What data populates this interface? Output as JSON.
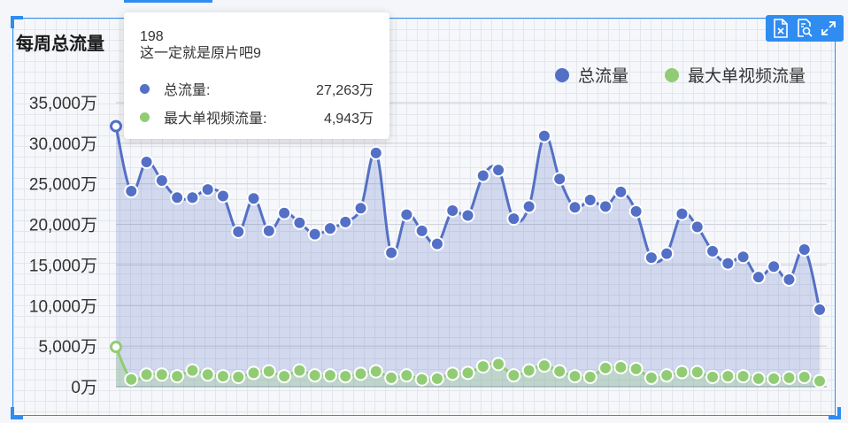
{
  "title": "每周总流量",
  "toolbar": {
    "icons": [
      "export-file-icon",
      "search-report-icon",
      "fullscreen-icon"
    ]
  },
  "tooltip": {
    "header_line1": "198",
    "header_line2": "这一定就是原片吧9",
    "rows": [
      {
        "name": "总流量:",
        "value": "27,263万",
        "color": "#5470c6"
      },
      {
        "name": "最大单视频流量:",
        "value": "4,943万",
        "color": "#91cc75"
      }
    ]
  },
  "legend": [
    {
      "name": "总流量",
      "color": "#5470c6"
    },
    {
      "name": "最大单视频流量",
      "color": "#91cc75"
    }
  ],
  "chart_data": {
    "type": "area",
    "title": "每周总流量",
    "ylim": [
      0,
      35000
    ],
    "yticks": [
      "0万",
      "5,000万",
      "10,000万",
      "15,000万",
      "20,000万",
      "25,000万",
      "30,000万",
      "35,000万"
    ],
    "ytick_values": [
      0,
      5000,
      10000,
      15000,
      20000,
      25000,
      30000,
      35000
    ],
    "grid": true,
    "legend_position": "top-right",
    "smooth": true,
    "series": [
      {
        "name": "总流量",
        "color": "#5470c6",
        "values": [
          32100,
          24100,
          27700,
          25400,
          23300,
          23300,
          24300,
          23500,
          19100,
          23200,
          19200,
          21400,
          20200,
          18800,
          19500,
          20300,
          22000,
          28800,
          16500,
          21200,
          19200,
          17600,
          21700,
          21100,
          26000,
          26700,
          20700,
          22200,
          30900,
          25600,
          22100,
          23000,
          22200,
          24000,
          21600,
          15900,
          16400,
          21300,
          19700,
          16700,
          15200,
          16000,
          13500,
          14800,
          13200,
          16900,
          9500
        ]
      },
      {
        "name": "最大单视频流量",
        "color": "#91cc75",
        "values": [
          4900,
          900,
          1500,
          1500,
          1300,
          2000,
          1500,
          1300,
          1200,
          1700,
          1900,
          1300,
          2000,
          1400,
          1400,
          1300,
          1600,
          1900,
          1100,
          1400,
          900,
          1000,
          1600,
          1700,
          2500,
          2800,
          1400,
          2000,
          2600,
          1900,
          1300,
          1200,
          2300,
          2400,
          2200,
          1100,
          1400,
          1800,
          1800,
          1200,
          1300,
          1300,
          1000,
          1000,
          1100,
          1200,
          700
        ]
      }
    ]
  }
}
